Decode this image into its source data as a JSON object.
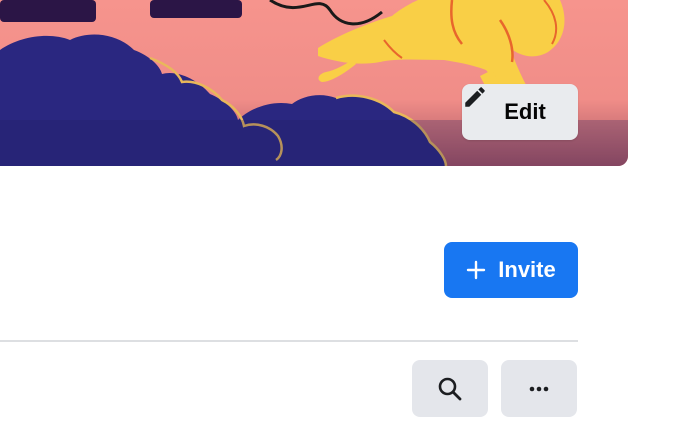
{
  "cover": {
    "edit_button": {
      "icon": "pencil-icon",
      "label": "Edit"
    }
  },
  "actions": {
    "invite_button": {
      "icon": "plus-icon",
      "label": "Invite"
    },
    "search_button": {
      "icon": "search-icon"
    },
    "more_button": {
      "icon": "more-horizontal-icon"
    }
  },
  "colors": {
    "primary": "#1877f2",
    "secondary_button_bg": "#e4e6eb",
    "cover_pink": "#f4958f",
    "cover_navy": "#2a2780",
    "cover_yellow": "#f9d048",
    "divider": "#dddfe2"
  }
}
